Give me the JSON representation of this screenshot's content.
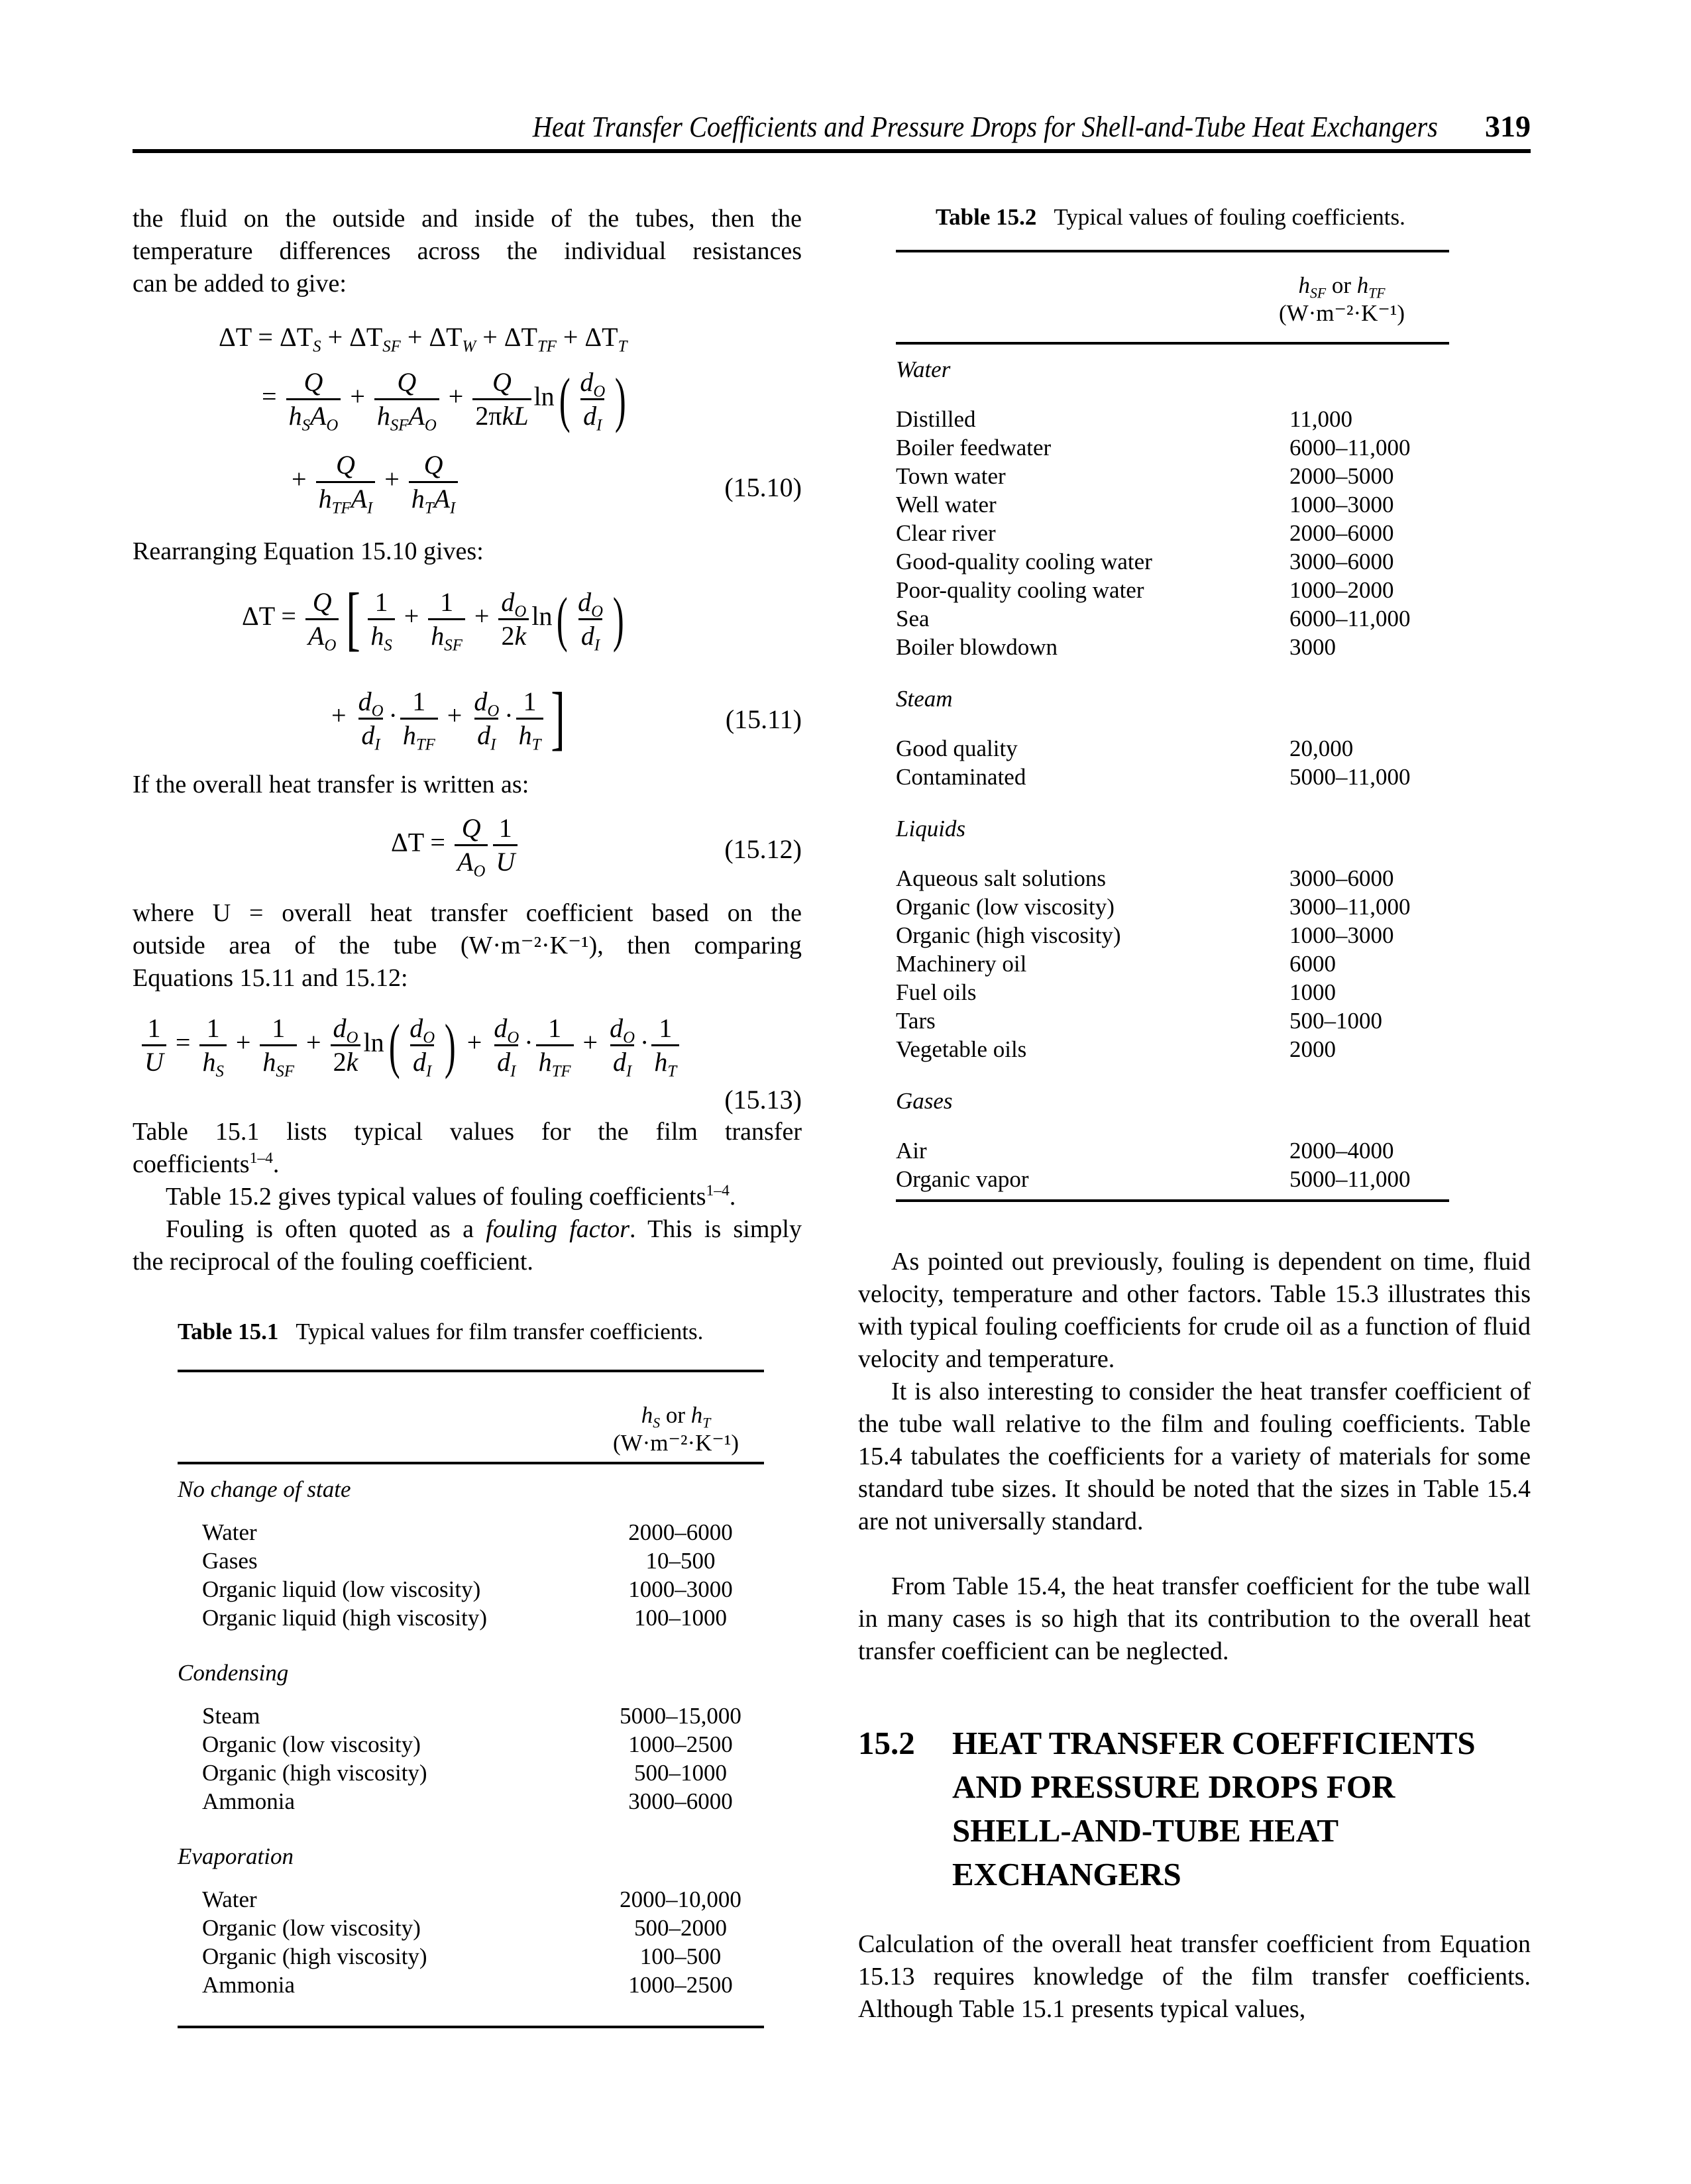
{
  "header": {
    "running_title": "Heat Transfer Coefficients and Pressure Drops for Shell-and-Tube Heat Exchangers",
    "page_number": "319"
  },
  "left": {
    "intro_lines": [
      "the fluid on the outside and inside of the tubes, then the",
      "temperature differences across the individual resistances",
      "can be added to give:"
    ],
    "eq_15_10": {
      "line1": "ΔT = ΔT_S + ΔT_SF + ΔT_W + ΔT_TF + ΔT_T",
      "line2": "= Q/(h_S A_O) + Q/(h_SF A_O) + Q/(2πkL) ln(d_O/d_I)",
      "line3": "+ Q/(h_TF A_I) + Q/(h_T A_I)",
      "number": "(15.10)"
    },
    "rearranging": "Rearranging Equation 15.10 gives:",
    "eq_15_11": {
      "line1": "ΔT = Q/A_O [1/h_S + 1/h_SF + d_O/2k ln(d_O/d_I)",
      "line2": "+ d_O/d_I · 1/h_TF + d_O/d_I · 1/h_T]",
      "number": "(15.11)"
    },
    "if_overall": "If the overall heat transfer is written as:",
    "eq_15_12": {
      "expr": "ΔT = Q/A_O · 1/U",
      "number": "(15.12)"
    },
    "where_lines": [
      "where  U = overall heat transfer coefficient based on the",
      "outside area of the tube (W·m⁻²·K⁻¹), then comparing",
      "Equations 15.11 and 15.12:"
    ],
    "eq_15_13": {
      "expr": "1/U = 1/h_S + 1/h_SF + d_O/2k ln(d_O/d_I) + d_O/d_I · 1/h_TF + d_O/d_I · 1/h_T",
      "number": "(15.13)"
    },
    "para_table1_a": "Table 15.1 lists typical values for the film transfer",
    "para_table1_b": "coefficients",
    "para_table1_sup": "1–4",
    "para_table2": "Table 15.2 gives typical values of fouling coefficients",
    "para_table2_sup": "1–4",
    "para_fouling_1": "Fouling is often quoted as a ",
    "para_fouling_em": "fouling factor",
    "para_fouling_2": ". This is simply",
    "para_fouling_3": "the reciprocal of the fouling coefficient."
  },
  "table1": {
    "label": "Table 15.1",
    "caption": "Typical values for film transfer coefficients.",
    "col_header_sym": "h_S or h_T",
    "col_header_unit": "(W·m⁻²·K⁻¹)",
    "groups": [
      {
        "name": "No change of state",
        "rows": [
          {
            "item": "Water",
            "value": "2000–6000"
          },
          {
            "item": "Gases",
            "value": "10–500"
          },
          {
            "item": "Organic liquid (low viscosity)",
            "value": "1000–3000"
          },
          {
            "item": "Organic liquid (high viscosity)",
            "value": "100–1000"
          }
        ]
      },
      {
        "name": "Condensing",
        "rows": [
          {
            "item": "Steam",
            "value": "5000–15,000"
          },
          {
            "item": "Organic (low viscosity)",
            "value": "1000–2500"
          },
          {
            "item": "Organic (high viscosity)",
            "value": "500–1000"
          },
          {
            "item": "Ammonia",
            "value": "3000–6000"
          }
        ]
      },
      {
        "name": "Evaporation",
        "rows": [
          {
            "item": "Water",
            "value": "2000–10,000"
          },
          {
            "item": "Organic (low viscosity)",
            "value": "500–2000"
          },
          {
            "item": "Organic (high viscosity)",
            "value": "100–500"
          },
          {
            "item": "Ammonia",
            "value": "1000–2500"
          }
        ]
      }
    ]
  },
  "table2": {
    "label": "Table 15.2",
    "caption": "Typical values of fouling coefficients.",
    "col_header_sym": "h_SF or h_TF",
    "col_header_unit": "(W·m⁻²·K⁻¹)",
    "groups": [
      {
        "name": "Water",
        "rows": [
          {
            "item": "Distilled",
            "value": "11,000"
          },
          {
            "item": "Boiler feedwater",
            "value": "6000–11,000"
          },
          {
            "item": "Town water",
            "value": "2000–5000"
          },
          {
            "item": "Well water",
            "value": "1000–3000"
          },
          {
            "item": "Clear river",
            "value": "2000–6000"
          },
          {
            "item": "Good-quality cooling water",
            "value": "3000–6000"
          },
          {
            "item": "Poor-quality cooling water",
            "value": "1000–2000"
          },
          {
            "item": "Sea",
            "value": "6000–11,000"
          },
          {
            "item": "Boiler blowdown",
            "value": "3000"
          }
        ]
      },
      {
        "name": "Steam",
        "rows": [
          {
            "item": "Good quality",
            "value": "20,000"
          },
          {
            "item": "Contaminated",
            "value": "5000–11,000"
          }
        ]
      },
      {
        "name": "Liquids",
        "rows": [
          {
            "item": "Aqueous salt solutions",
            "value": "3000–6000"
          },
          {
            "item": "Organic (low viscosity)",
            "value": "3000–11,000"
          },
          {
            "item": "Organic (high viscosity)",
            "value": "1000–3000"
          },
          {
            "item": "Machinery oil",
            "value": "6000"
          },
          {
            "item": "Fuel oils",
            "value": "1000"
          },
          {
            "item": "Tars",
            "value": "500–1000"
          },
          {
            "item": "Vegetable oils",
            "value": "2000"
          }
        ]
      },
      {
        "name": "Gases",
        "rows": [
          {
            "item": "Air",
            "value": "2000–4000"
          },
          {
            "item": "Organic vapor",
            "value": "5000–11,000"
          }
        ]
      }
    ]
  },
  "right": {
    "para1": "As pointed out previously, fouling is dependent on time, fluid velocity, temperature and other factors. Table 15.3 illustrates this with typical fouling coefficients for crude oil as a function of fluid velocity and temperature.",
    "para2": "It is also interesting to consider the heat transfer coefficient of the tube wall relative to the film and fouling coefficients. Table 15.4 tabulates the coefficients for a variety of materials for some standard tube sizes. It should be noted that the sizes in Table 15.4 are not universally standard.",
    "para3": "From Table 15.4, the heat transfer coefficient for the tube wall in many cases is so high that its contribution to the overall heat transfer coefficient can be neglected.",
    "section_number": "15.2",
    "section_title_lines": [
      "HEAT TRANSFER COEFFICIENTS",
      "AND PRESSURE DROPS FOR",
      "SHELL-AND-TUBE HEAT",
      "EXCHANGERS"
    ],
    "para4": "Calculation of the overall heat transfer coefficient from Equation 15.13 requires knowledge of the film transfer coefficients. Although Table 15.1 presents typical values,"
  }
}
